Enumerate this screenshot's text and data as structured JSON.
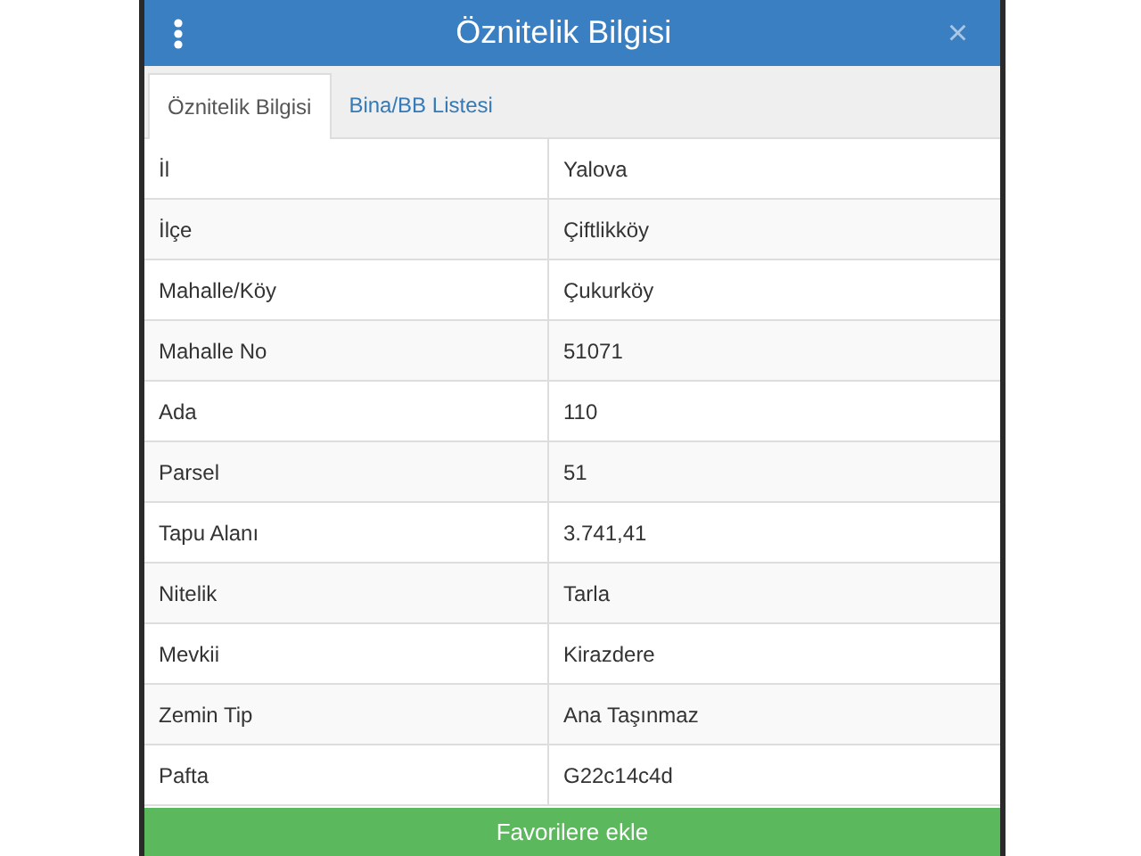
{
  "window": {
    "title": "Öznitelik Bilgisi",
    "close": "×"
  },
  "tabs": [
    {
      "label": "Öznitelik Bilgisi",
      "selected": true
    },
    {
      "label": "Bina/BB Listesi",
      "selected": false
    }
  ],
  "rows": [
    {
      "name": "İl",
      "value": "Yalova"
    },
    {
      "name": "İlçe",
      "value": "Çiftlikköy"
    },
    {
      "name": "Mahalle/Köy",
      "value": "Çukurköy"
    },
    {
      "name": "Mahalle No",
      "value": "51071"
    },
    {
      "name": "Ada",
      "value": "110"
    },
    {
      "name": "Parsel",
      "value": "51"
    },
    {
      "name": "Tapu Alanı",
      "value": "3.741,41"
    },
    {
      "name": "Nitelik",
      "value": "Tarla"
    },
    {
      "name": "Mevkii",
      "value": "Kirazdere"
    },
    {
      "name": "Zemin Tip",
      "value": "Ana Taşınmaz"
    },
    {
      "name": "Pafta",
      "value": "G22c14c4d"
    }
  ],
  "button": "Favorilere ekle"
}
